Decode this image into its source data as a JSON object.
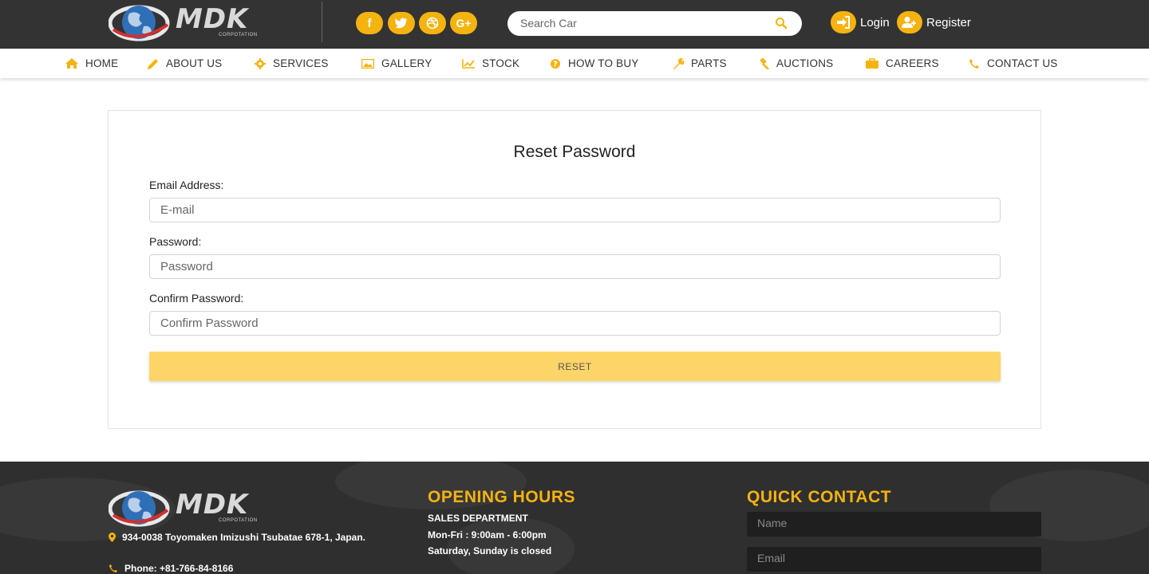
{
  "brand": {
    "name": "MDK",
    "sub": "CORPOTATION"
  },
  "header": {
    "social": [
      {
        "icon": "facebook-icon",
        "glyph": "f"
      },
      {
        "icon": "twitter-icon",
        "glyph": "t"
      },
      {
        "icon": "dribbble-icon",
        "glyph": "d"
      },
      {
        "icon": "google-plus-icon",
        "glyph": "G+"
      }
    ],
    "search": {
      "placeholder": "Search Car"
    },
    "login_label": "Login",
    "register_label": "Register",
    "accent": "#f5b30f"
  },
  "nav": {
    "items": [
      {
        "label": "HOME",
        "icon": "home-icon"
      },
      {
        "label": "ABOUT US",
        "icon": "pencil-icon"
      },
      {
        "label": "SERVICES",
        "icon": "gear-icon"
      },
      {
        "label": "GALLERY",
        "icon": "image-icon"
      },
      {
        "label": "STOCK",
        "icon": "chart-line-icon"
      },
      {
        "label": "HOW TO BUY",
        "icon": "question-icon"
      },
      {
        "label": "PARTS",
        "icon": "wrench-icon"
      },
      {
        "label": "AUCTIONS",
        "icon": "gavel-icon"
      },
      {
        "label": "CAREERS",
        "icon": "briefcase-icon"
      },
      {
        "label": "CONTACT US",
        "icon": "phone-icon"
      }
    ]
  },
  "form": {
    "title": "Reset Password",
    "email_label": "Email Address:",
    "email_placeholder": "E-mail",
    "password_label": "Password:",
    "password_placeholder": "Password",
    "confirm_label": "Confirm Password:",
    "confirm_placeholder": "Confirm Password",
    "submit_label": "RESET",
    "button_color": "#fdd467"
  },
  "footer": {
    "address": "934-0038 Toyomaken Imizushi Tsubatae 678-1, Japan.",
    "phone": "Phone: +81-766-84-8166",
    "hours_title": "OPENING HOURS",
    "department": "SALES DEPARTMENT",
    "weekday_hours": "Mon-Fri : 9:00am - 6:00pm",
    "weekend_note": "Saturday, Sunday is closed",
    "contact_title": "QUICK CONTACT",
    "name_placeholder": "Name",
    "email_placeholder": "Email"
  }
}
